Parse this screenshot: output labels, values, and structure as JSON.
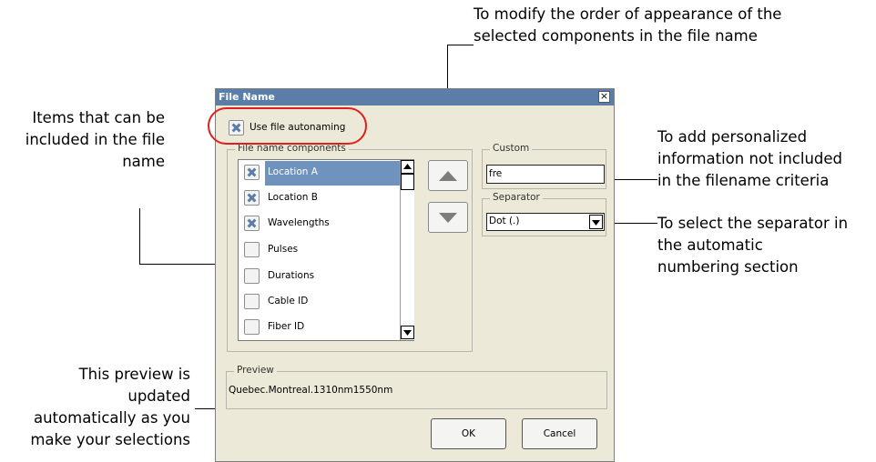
{
  "annotations": {
    "items_note": [
      "Items that can be",
      "included in the file",
      "name"
    ],
    "order_note": [
      "To modify the order of appearance of the",
      "selected components in the file name"
    ],
    "custom_note": [
      "To add personalized",
      "information not included",
      "in the filename criteria"
    ],
    "separator_note": [
      "To select the separator in",
      "the automatic",
      "numbering section"
    ],
    "preview_note": [
      "This preview is",
      "updated",
      "automatically as you",
      "make your selections"
    ]
  },
  "dialog": {
    "title": "File Name",
    "close_glyph": "×",
    "autonaming": {
      "label": "Use file autonaming",
      "checked": true
    },
    "components": {
      "label": "File name components",
      "items": [
        {
          "label": "Location A",
          "checked": true,
          "selected": true
        },
        {
          "label": "Location B",
          "checked": true,
          "selected": false
        },
        {
          "label": "Wavelengths",
          "checked": true,
          "selected": false
        },
        {
          "label": "Pulses",
          "checked": false,
          "selected": false
        },
        {
          "label": "Durations",
          "checked": false,
          "selected": false
        },
        {
          "label": "Cable ID",
          "checked": false,
          "selected": false
        },
        {
          "label": "Fiber ID",
          "checked": false,
          "selected": false
        }
      ]
    },
    "move_up_icon": "triangle-up-icon",
    "move_down_icon": "triangle-down-icon",
    "custom": {
      "label": "Custom",
      "value": "fre"
    },
    "separator": {
      "label": "Separator",
      "value": "Dot (.)"
    },
    "preview": {
      "label": "Preview",
      "value": "Quebec.Montreal.1310nm1550nm"
    },
    "ok_label": "OK",
    "cancel_label": "Cancel"
  },
  "colors": {
    "highlight_ring": "#e0201e",
    "title_bar": "#5a7ea8",
    "selection": "#6f93bd",
    "dialog_bg": "#ece9d8"
  }
}
